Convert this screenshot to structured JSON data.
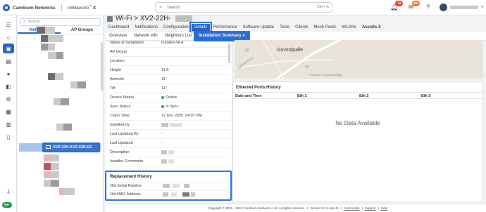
{
  "header": {
    "brand": "Cambium Networks",
    "product": "cnMaestro",
    "product_suffix": "X",
    "product_tm": "™",
    "search_placeholder": "Search",
    "search_shortcut": "Ctrl + K",
    "alerts_count": "12",
    "events_count": "99+"
  },
  "rail": {
    "items": [
      "home-icon",
      "devices-icon",
      "map-icon",
      "location-icon",
      "tasks-icon",
      "settings-icon",
      "apps-icon",
      "reports-icon",
      "book-icon"
    ],
    "bottom_badge": "99+"
  },
  "tree": {
    "search_placeholder": "Search",
    "tabs": [
      "Networks",
      "AP Groups"
    ],
    "selected_label": "XV2-22H-XV2-22H-E9"
  },
  "page": {
    "title_prefix": "Wi-Fi > XV2-22H-"
  },
  "tabs_primary": [
    "Dashboard",
    "Notifications",
    "Configuration",
    "Details",
    "Performance",
    "Software Update",
    "Tools",
    "Clients",
    "Mesh Peers",
    "WLANs",
    "Assists X"
  ],
  "tabs_primary_active": "Details",
  "tabs_secondary": [
    "Overview",
    "Network Info",
    "Neighbors List",
    "Installation Summary"
  ],
  "tabs_secondary_active": "Installation Summary",
  "details": {
    "rows": [
      {
        "label": "Name at Installation",
        "value": "Installer-W-4"
      },
      {
        "label": "AP Group",
        "value": ""
      },
      {
        "label": "Location",
        "value": ""
      },
      {
        "label": "Height",
        "value": "11 ft"
      },
      {
        "label": "Azimuth",
        "value": "11°"
      },
      {
        "label": "Tilt",
        "value": "11°"
      },
      {
        "label": "Device Status",
        "value": "Online"
      },
      {
        "label": "Sync Status",
        "value": "In Sync"
      },
      {
        "label": "Claim Time",
        "value": "12 Dec 2025, 04:07 PM"
      },
      {
        "label": "Installed by",
        "value": ""
      },
      {
        "label": "Last Updated By",
        "value": "-"
      },
      {
        "label": "Last Updated",
        "value": "-"
      },
      {
        "label": "Description",
        "value": ""
      },
      {
        "label": "Installer Comments",
        "value": ""
      }
    ],
    "status_color": "#1b9a4a"
  },
  "replacement": {
    "title": "Replacement History",
    "rows": [
      {
        "label": "Old Serial Number"
      },
      {
        "label": "Old MAC Address"
      }
    ]
  },
  "map": {
    "place": "Govindpalle",
    "road": "Jaihind Road",
    "credit": "© MapTiler © OpenStreetMap"
  },
  "ethernet": {
    "title": "Ethernet Ports History",
    "columns": [
      "Date and Time",
      "Eth 1",
      "Eth 2",
      "Eth 3"
    ],
    "empty": "No Data Available"
  },
  "footer": {
    "copyright": "Copyright © 2015 - 2025 Cambium Networks, Ltd. All rights reserved.",
    "version": "Version 5.2.5-sp1-r5",
    "links": [
      "Community",
      "Support",
      "Help"
    ]
  },
  "colors": {
    "accent": "#2462c5",
    "highlight_border": "#1a6fe0",
    "badge_red": "#e8412e",
    "badge_orange": "#f07a22"
  }
}
